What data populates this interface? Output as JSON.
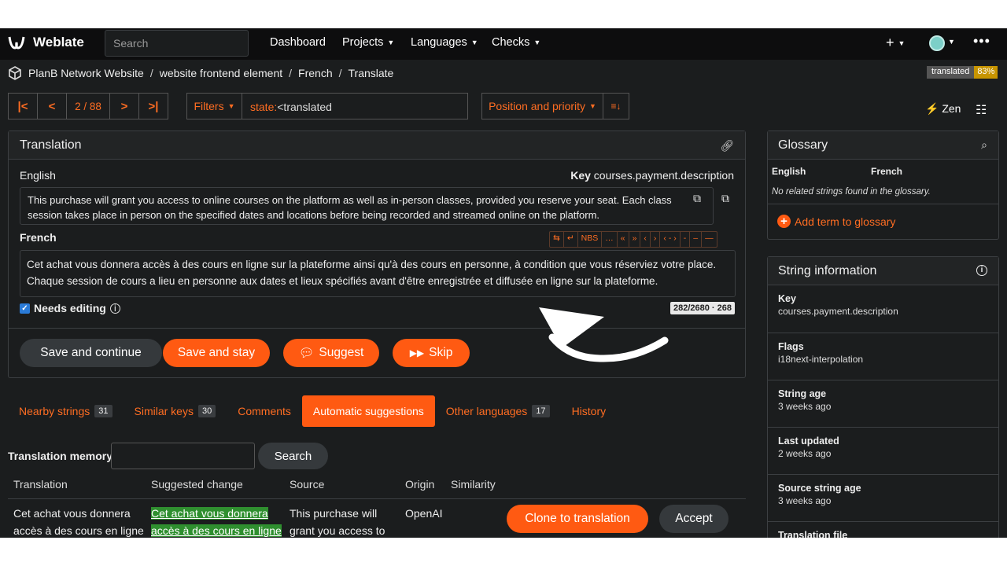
{
  "nav": {
    "brand": "Weblate",
    "search_placeholder": "Search",
    "links": [
      "Dashboard",
      "Projects",
      "Languages",
      "Checks"
    ],
    "plus": "+",
    "more": "•••"
  },
  "breadcrumb": [
    "PlanB Network Website",
    "website frontend element",
    "French",
    "Translate"
  ],
  "badge": {
    "label": "translated",
    "value": "83%"
  },
  "pager": {
    "first": "|<",
    "prev": "<",
    "position": "2 / 88",
    "next": ">",
    "last": ">|"
  },
  "filters": {
    "label": "Filters",
    "query_key": "state:",
    "query_value": "<translated"
  },
  "sort": {
    "label": "Position and priority",
    "order_icon": "sort-icon"
  },
  "zen": "Zen",
  "translation": {
    "title": "Translation",
    "source_lang": "English",
    "key_label": "Key",
    "key_value": "courses.payment.description",
    "source_text": "This purchase will grant you access to online courses on the platform as well as in-person classes, provided you reserve your seat. Each class session takes place in person on the specified dates and locations before being recorded and streamed online on the platform.",
    "target_lang": "French",
    "specials": [
      "⇆",
      "↵",
      "NBS",
      "…",
      "«",
      "»",
      "‹",
      "›",
      "‹ - ›",
      "-",
      "–",
      "—"
    ],
    "target_text": "Cet achat vous donnera accès à des cours en ligne sur la plateforme ainsi qu'à des cours en personne, à condition que vous réserviez votre place. Chaque session de cours a lieu en personne aux dates et lieux spécifiés avant d'être enregistrée et diffusée en ligne sur la plateforme.",
    "needs_editing": "Needs editing",
    "counter": "282/2680 · 268",
    "buttons": {
      "save_continue": "Save and continue",
      "save_stay": "Save and stay",
      "suggest": "Suggest",
      "skip": "Skip"
    }
  },
  "tabs": [
    {
      "label": "Nearby strings",
      "count": "31"
    },
    {
      "label": "Similar keys",
      "count": "30"
    },
    {
      "label": "Comments",
      "count": ""
    },
    {
      "label": "Automatic suggestions",
      "count": ""
    },
    {
      "label": "Other languages",
      "count": "17"
    },
    {
      "label": "History",
      "count": ""
    }
  ],
  "tm": {
    "label": "Translation memory",
    "search": "Search",
    "headers": [
      "Translation",
      "Suggested change",
      "Source",
      "Origin",
      "Similarity"
    ],
    "row": {
      "translation_l1": "Cet achat vous donnera",
      "translation_l2": "accès à des cours en ligne",
      "suggested_l1": "Cet achat vous donnera",
      "suggested_l2": "accès à des cours en ligne",
      "source_l1": "This purchase will",
      "source_l2": "grant you access to",
      "origin": "OpenAI"
    },
    "clone": "Clone to translation",
    "accept": "Accept"
  },
  "glossary": {
    "title": "Glossary",
    "col_source": "English",
    "col_target": "French",
    "empty": "No related strings found in the glossary.",
    "add": "Add term to glossary"
  },
  "string_info": {
    "title": "String information",
    "rows": [
      {
        "k": "Key",
        "v": "courses.payment.description"
      },
      {
        "k": "Flags",
        "v": "i18next-interpolation"
      },
      {
        "k": "String age",
        "v": "3 weeks ago"
      },
      {
        "k": "Last updated",
        "v": "2 weeks ago"
      },
      {
        "k": "Source string age",
        "v": "3 weeks ago"
      },
      {
        "k": "Translation file",
        "v": ""
      }
    ]
  },
  "colors": {
    "accent": "#ff5a12",
    "bg": "#1b1d1e",
    "nav": "#0d0d0e"
  }
}
